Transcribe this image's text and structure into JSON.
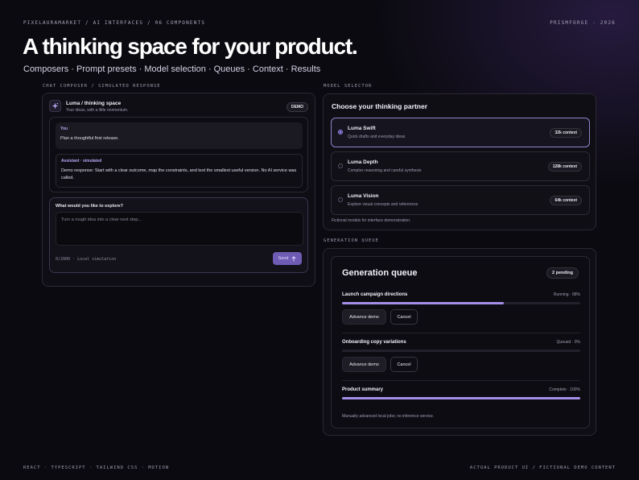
{
  "header": {
    "breadcrumb": "PIXELAURAMARKET / AI INTERFACES / 06 COMPONENTS",
    "brand": "PRISMFORGE · 2026",
    "title": "A thinking space for your product.",
    "subtitle": "Composers · Prompt presets · Model selection · Queues · Context · Results"
  },
  "chat": {
    "section_label": "CHAT COMPOSER / SIMULATED RESPONSE",
    "title": "Luma / thinking space",
    "subtitle": "Your ideas, with a little momentum.",
    "badge": "DEMO",
    "user_label": "You",
    "user_message": "Plan a thoughtful first release.",
    "assistant_label": "Assistant · simulated",
    "assistant_message": "Demo response: Start with a clear outcome, map the constraints, and test the smallest useful version. No AI service was called.",
    "composer_label": "What would you like to explore?",
    "placeholder": "Turn a rough idea into a clear next step...",
    "counter": "0/2000 · Local simulation",
    "send_label": "Send",
    "send_icon": "arrow-up-icon"
  },
  "models": {
    "section_label": "MODEL SELECTOR",
    "title": "Choose your thinking partner",
    "items": [
      {
        "name": "Luma Swift",
        "desc": "Quick drafts and everyday ideas",
        "context": "32k context",
        "selected": true
      },
      {
        "name": "Luma Depth",
        "desc": "Complex reasoning and careful synthesis",
        "context": "128k context",
        "selected": false
      },
      {
        "name": "Luma Vision",
        "desc": "Explore visual concepts and references",
        "context": "64k context",
        "selected": false
      }
    ],
    "note": "Fictional models for interface demonstration."
  },
  "queue": {
    "section_label": "GENERATION QUEUE",
    "title": "Generation queue",
    "pending": "2 pending",
    "advance_label": "Advance demo",
    "cancel_label": "Cancel",
    "jobs": [
      {
        "name": "Launch campaign directions",
        "status": "Running · 68%",
        "progress": 0.68
      },
      {
        "name": "Onboarding copy variations",
        "status": "Queued · 0%",
        "progress": 0
      },
      {
        "name": "Product summary",
        "status": "Complete · 100%",
        "progress": 1.0
      }
    ],
    "note": "Manually advanced local jobs; no inference service."
  },
  "footer": {
    "left": "REACT · TYPESCRIPT · TAILWIND CSS · MOTION",
    "right": "ACTUAL PRODUCT UI / FICTIONAL DEMO CONTENT"
  },
  "colors": {
    "accent": "#a48fe8",
    "send_bg": "#6e5bb4",
    "background": "#0b0a10"
  }
}
